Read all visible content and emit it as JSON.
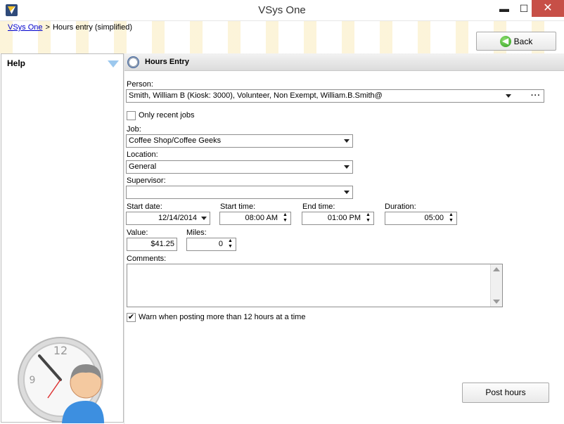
{
  "window": {
    "title": "VSys One",
    "minimize": "▬",
    "maximize": "☐",
    "close": "✕"
  },
  "breadcrumb": {
    "root": "VSys One",
    "separator": ">",
    "current": "Hours entry (simplified)"
  },
  "toolbar": {
    "back_label": "Back",
    "back_icon": "◀"
  },
  "help": {
    "title": "Help"
  },
  "section": {
    "title": "Hours Entry"
  },
  "form": {
    "person_label": "Person:",
    "person_value": "Smith, William B (Kiosk: 3000), Volunteer, Non Exempt, William.B.Smith@",
    "person_more": "···",
    "only_recent_label": "Only recent jobs",
    "only_recent_checked": "",
    "job_label": "Job:",
    "job_value": "Coffee Shop/Coffee Geeks",
    "location_label": "Location:",
    "location_value": "General",
    "supervisor_label": "Supervisor:",
    "supervisor_value": "",
    "start_date_label": "Start date:",
    "start_date_value": "12/14/2014",
    "start_time_label": "Start time:",
    "start_time_value": "08:00 AM",
    "end_time_label": "End time:",
    "end_time_value": "01:00 PM",
    "duration_label": "Duration:",
    "duration_value": "05:00",
    "value_label": "Value:",
    "value_value": "$41.25",
    "miles_label": "Miles:",
    "miles_value": "0",
    "comments_label": "Comments:",
    "warn_label": "Warn when posting more than 12 hours at a time",
    "warn_checked": "✔",
    "spin_symbol": "▲\n▼"
  },
  "actions": {
    "post_label": "Post hours"
  }
}
